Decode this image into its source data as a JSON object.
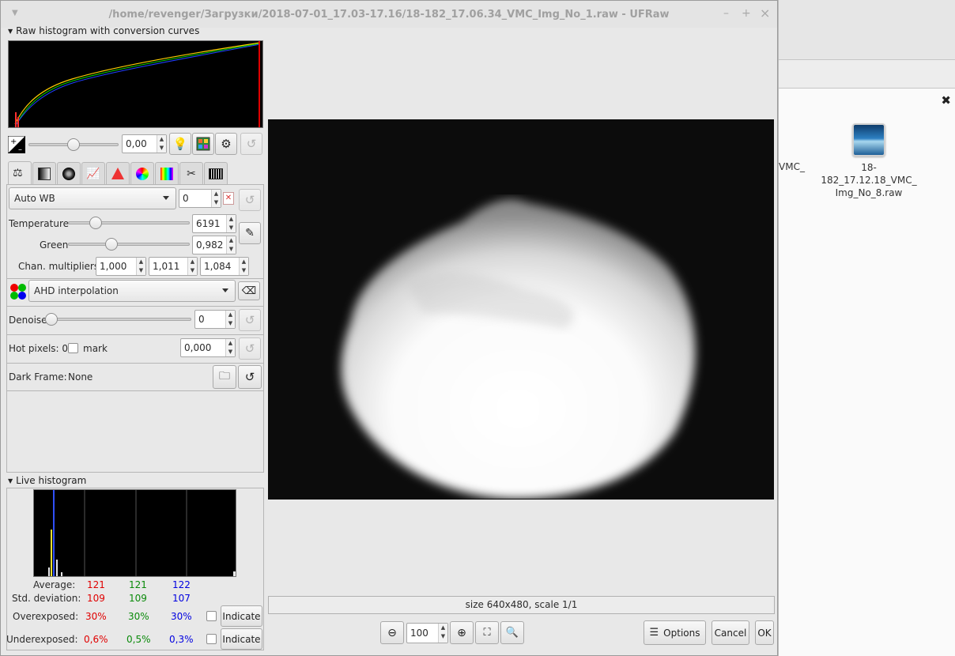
{
  "window": {
    "title": "/home/revenger/Загрузки/2018-07-01_17.03-17.16/18-182_17.06.34_VMC_Img_No_1.raw - UFRaw",
    "min": "–",
    "max": "+",
    "close": "×"
  },
  "raw_histogram": {
    "label": "Raw histogram with conversion curves"
  },
  "exposure": {
    "value": "0,00",
    "slider_pos": 0.5
  },
  "white_balance": {
    "preset": "Auto WB",
    "fine_tune": "0",
    "temperature_label": "Temperature",
    "temperature": "6191",
    "green_label": "Green",
    "green": "0,982",
    "chan_label": "Chan. multipliers:",
    "multipliers": [
      "1,000",
      "1,011",
      "1,084"
    ]
  },
  "interpolation": {
    "value": "AHD interpolation"
  },
  "denoise": {
    "label": "Denoise",
    "value": "0"
  },
  "hot_pixels": {
    "label": "Hot pixels: 0",
    "mark_label": "mark",
    "value": "0,000"
  },
  "dark_frame": {
    "label": "Dark Frame:",
    "value": "None"
  },
  "live_histogram": {
    "label": "Live histogram",
    "average_label": "Average:",
    "average": [
      "121",
      "121",
      "122"
    ],
    "std_label": "Std. deviation:",
    "std": [
      "109",
      "109",
      "107"
    ],
    "over_label": "Overexposed:",
    "over": [
      "30%",
      "30%",
      "30%"
    ],
    "under_label": "Underexposed:",
    "under": [
      "0,6%",
      "0,5%",
      "0,3%"
    ],
    "indicate_label": "Indicate"
  },
  "preview": {
    "status": "size 640x480, scale 1/1"
  },
  "zoom": {
    "value": "100"
  },
  "buttons": {
    "options": "Options",
    "cancel": "Cancel",
    "ok": "OK"
  },
  "file_manager": {
    "file_name_line1": "18-182_17.12.18_VMC_",
    "file_name_line2": "Img_No_8.raw",
    "file_left_fragment": "VMC_",
    "close": "✖"
  }
}
